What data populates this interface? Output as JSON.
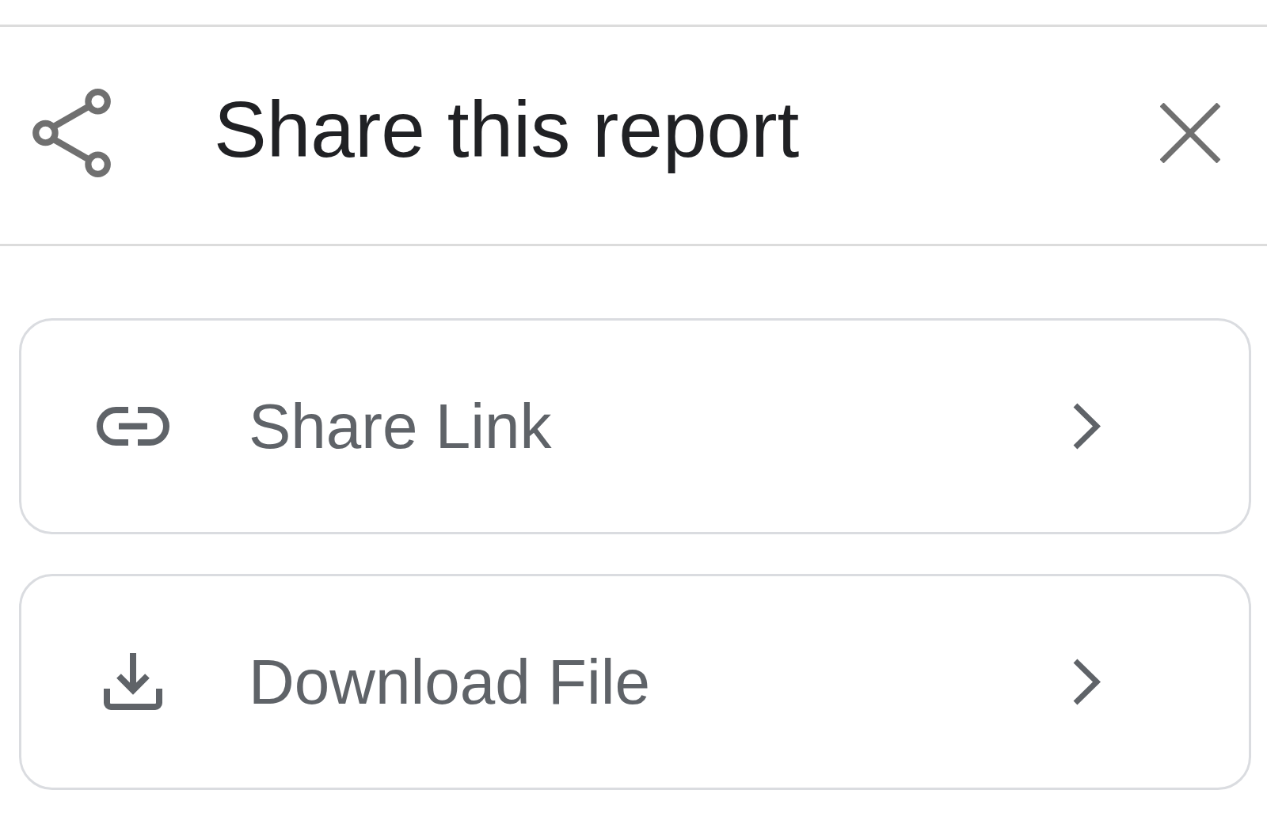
{
  "header": {
    "title": "Share this report"
  },
  "options": [
    {
      "kind": "link",
      "label": "Share Link"
    },
    {
      "kind": "download",
      "label": "Download File"
    }
  ]
}
